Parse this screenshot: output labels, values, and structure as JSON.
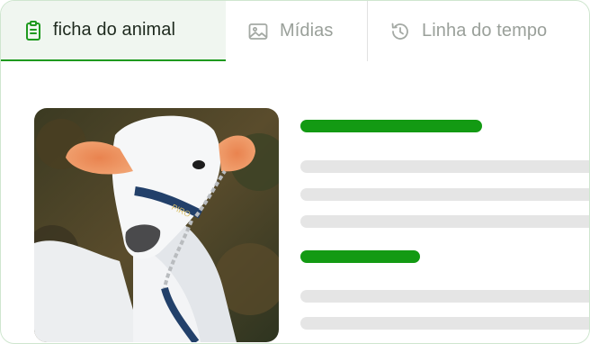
{
  "tabs": [
    {
      "label": "ficha do animal",
      "icon": "clipboard-icon",
      "active": true
    },
    {
      "label": "Mídias",
      "icon": "image-icon",
      "active": false
    },
    {
      "label": "Linha do tempo",
      "icon": "history-icon",
      "active": false
    }
  ],
  "colors": {
    "accent": "#139a13",
    "tab_active_bg": "#f0f6f0",
    "placeholder": "#e5e5e5",
    "inactive_text": "#9aa09a"
  },
  "photo": {
    "subject": "white-cow-photo"
  }
}
